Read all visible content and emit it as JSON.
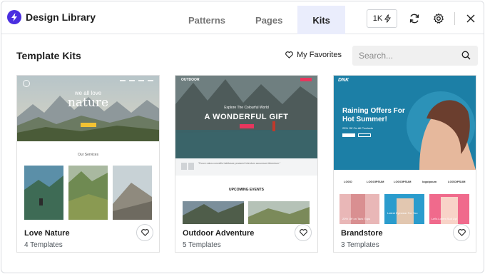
{
  "header": {
    "app_title": "Design Library",
    "tabs": [
      {
        "label": "Patterns"
      },
      {
        "label": "Pages"
      },
      {
        "label": "Kits"
      }
    ],
    "counter_label": "1K",
    "icons": [
      "bolt-icon",
      "refresh-icon",
      "gear-icon",
      "close-icon"
    ]
  },
  "toolbar": {
    "section_title": "Template Kits",
    "favorites_label": "My Favorites",
    "search_placeholder": "Search..."
  },
  "kits": [
    {
      "name": "Love Nature",
      "count_label": "4 Templates",
      "preview": {
        "hero_line1": "we all love",
        "hero_line2": "nature",
        "services_heading": "Our Services"
      }
    },
    {
      "name": "Outdoor Adventure",
      "count_label": "5 Templates",
      "preview": {
        "logo": "OUTDOOR",
        "kicker": "Explore The Colourful World",
        "headline": "A WONDERFUL GIFT",
        "quote": "“Fusce natus convallis habitasse praesent interdum accumsan bibendum.”",
        "events_heading": "UPCOMING EVENTS"
      }
    },
    {
      "name": "Brandstore",
      "count_label": "3 Templates",
      "preview": {
        "logo": "DNK",
        "headline_line1": "Raining Offers For",
        "headline_line2": "Hot Summer!",
        "offer": "25% Off On All Products",
        "brands": [
          "LOGO",
          "LOGOIPSUM",
          "LOGOIPSUM",
          "logoipsum",
          "LOGOIPSUM"
        ],
        "products": [
          "20% Off on Tank Tops",
          "Latest Eyewear For You",
          "Let's Lorem Suit Up!"
        ]
      }
    }
  ],
  "colors": {
    "accent": "#4a2fe0",
    "active_tab_bg": "#eaedfc",
    "adventure_button": "#e8365d",
    "brandstore_hero": "#1c7fa6"
  }
}
